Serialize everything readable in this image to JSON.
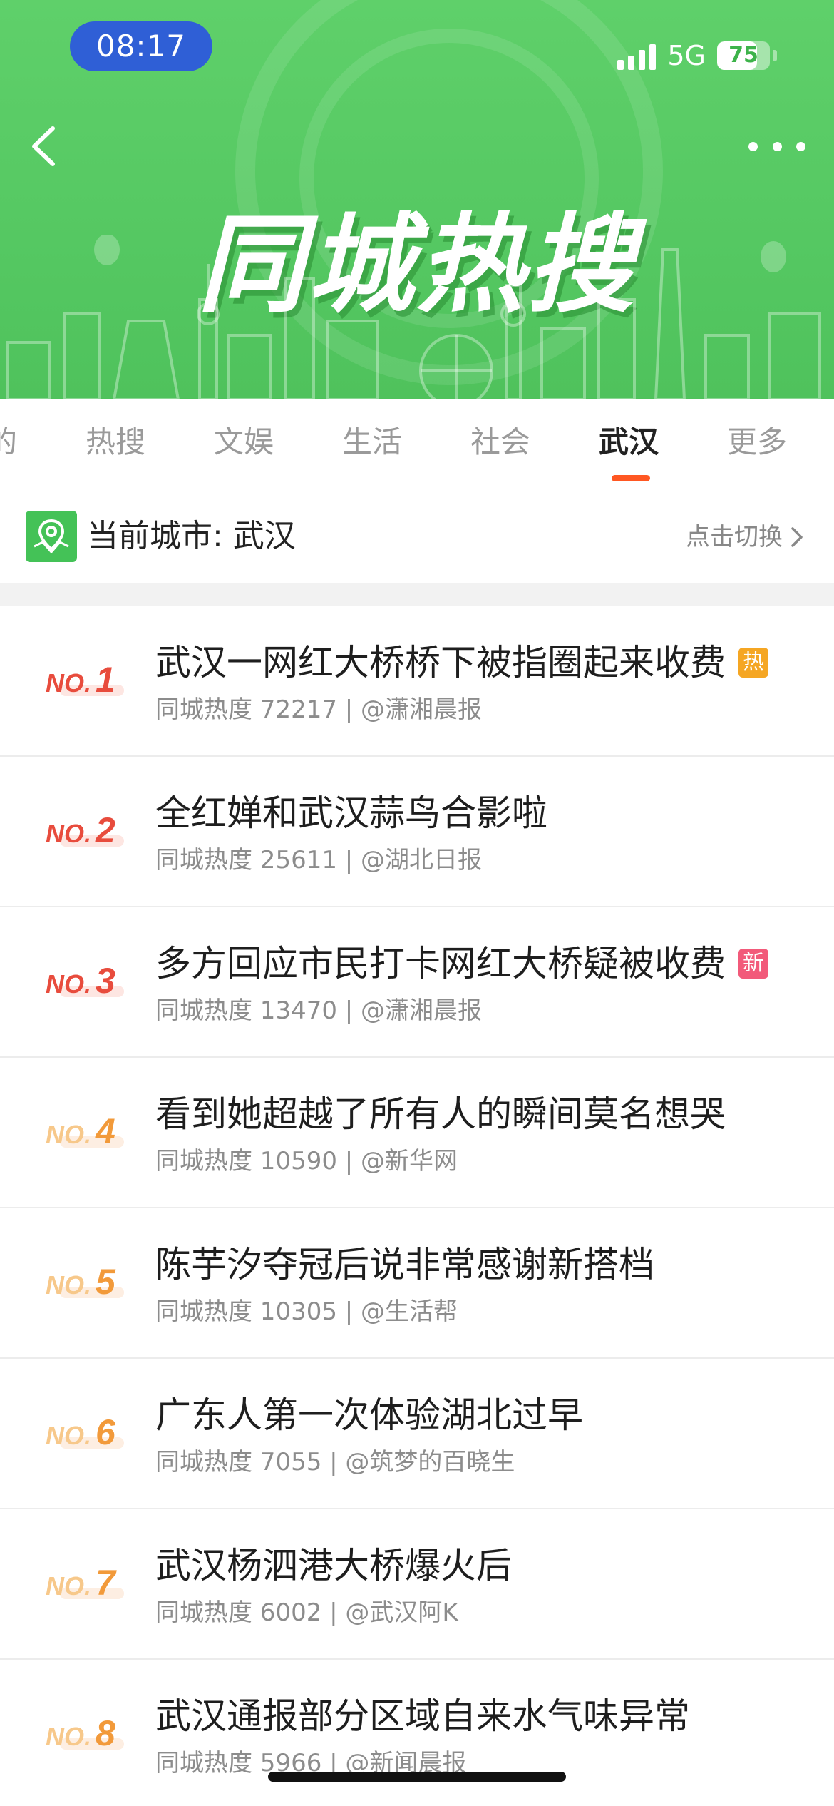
{
  "status_bar": {
    "time": "08:17",
    "network": "5G",
    "battery": "75",
    "battery_level": 0.75
  },
  "header": {
    "banner_title": "同城热搜"
  },
  "tabs": [
    {
      "label": "的",
      "active": false
    },
    {
      "label": "热搜",
      "active": false
    },
    {
      "label": "文娱",
      "active": false
    },
    {
      "label": "生活",
      "active": false
    },
    {
      "label": "社会",
      "active": false
    },
    {
      "label": "武汉",
      "active": true
    },
    {
      "label": "更多",
      "active": false
    }
  ],
  "city": {
    "label": "当前城市: 武汉",
    "switch_label": "点击切换"
  },
  "colors": {
    "accent": "#ff5722",
    "header_green": "#55c862",
    "badge_hot": "#f5a623",
    "badge_new": "#f25a7a"
  },
  "list": [
    {
      "rank": "1",
      "title": "武汉一网红大桥桥下被指圈起来收费",
      "badge": "热",
      "badge_type": "hot",
      "meta": "同城热度 72217 | @潇湘晨报"
    },
    {
      "rank": "2",
      "title": "全红婵和武汉蒜鸟合影啦",
      "badge": "",
      "badge_type": "",
      "meta": "同城热度 25611 | @湖北日报"
    },
    {
      "rank": "3",
      "title": "多方回应市民打卡网红大桥疑被收费",
      "badge": "新",
      "badge_type": "new",
      "meta": "同城热度 13470 | @潇湘晨报"
    },
    {
      "rank": "4",
      "title": "看到她超越了所有人的瞬间莫名想哭",
      "badge": "",
      "badge_type": "",
      "meta": "同城热度 10590 | @新华网"
    },
    {
      "rank": "5",
      "title": "陈芋汐夺冠后说非常感谢新搭档",
      "badge": "",
      "badge_type": "",
      "meta": "同城热度 10305 | @生活帮"
    },
    {
      "rank": "6",
      "title": "广东人第一次体验湖北过早",
      "badge": "",
      "badge_type": "",
      "meta": "同城热度 7055 | @筑梦的百晓生"
    },
    {
      "rank": "7",
      "title": "武汉杨泗港大桥爆火后",
      "badge": "",
      "badge_type": "",
      "meta": "同城热度 6002 | @武汉阿K"
    },
    {
      "rank": "8",
      "title": "武汉通报部分区域自来水气味异常",
      "badge": "",
      "badge_type": "",
      "meta": "同城热度 5966 | @新闻晨报"
    }
  ]
}
